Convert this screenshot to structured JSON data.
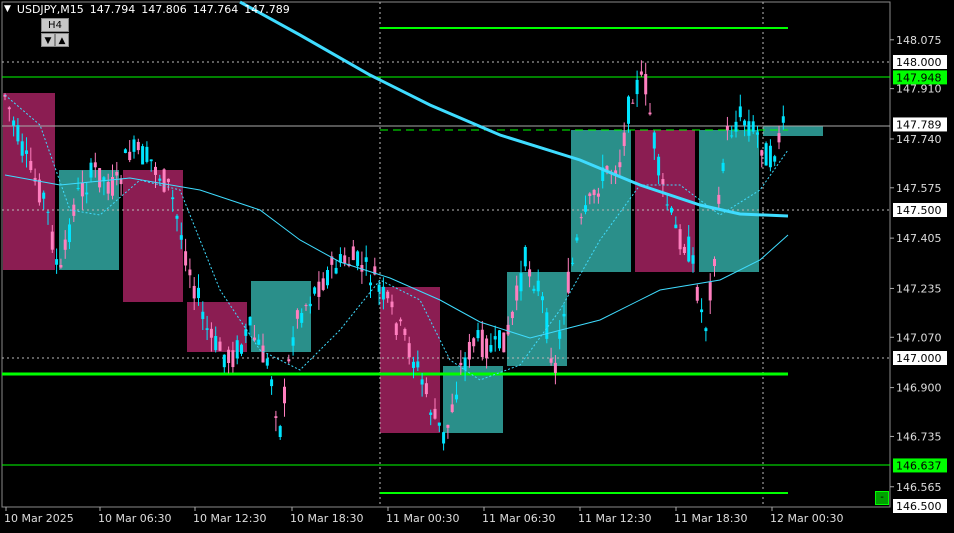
{
  "header": {
    "symbol_tf": "USDJPY,M15",
    "bid_open": "147.794",
    "high": "147.806",
    "low": "147.764",
    "close": "147.789"
  },
  "timeframe_box": {
    "label": "H4",
    "down_glyph": "▼",
    "up_glyph": "▲"
  },
  "corner_button": "-",
  "colors": {
    "background": "#000000",
    "bull_candle": "#00e5ff",
    "bear_candle": "#ff7fbf",
    "bull_box": "#2a8f8a",
    "bear_box": "#8b1d52",
    "ma_thick": "#3fdcff",
    "level_line": "#00ff00",
    "price_tag_text": "#000000",
    "price_tag_bg_white": "#ffffff",
    "price_tag_bg_green": "#00ff00"
  },
  "price_axis": {
    "ticks": [
      "148.075",
      "147.910",
      "147.740",
      "147.575",
      "147.405",
      "147.235",
      "147.070",
      "146.900",
      "146.735",
      "146.565"
    ],
    "tags": [
      {
        "text": "148.000",
        "style": "white"
      },
      {
        "text": "147.948",
        "style": "green"
      },
      {
        "text": "147.789",
        "style": "white"
      },
      {
        "text": "147.500",
        "style": "white"
      },
      {
        "text": "147.000",
        "style": "white"
      },
      {
        "text": "146.637",
        "style": "green"
      },
      {
        "text": "146.500",
        "style": "white"
      }
    ]
  },
  "time_axis": [
    "10 Mar 2025",
    "10 Mar 06:30",
    "10 Mar 12:30",
    "10 Mar 18:30",
    "11 Mar 00:30",
    "11 Mar 06:30",
    "11 Mar 12:30",
    "11 Mar 18:30",
    "12 Mar 00:30"
  ]
}
